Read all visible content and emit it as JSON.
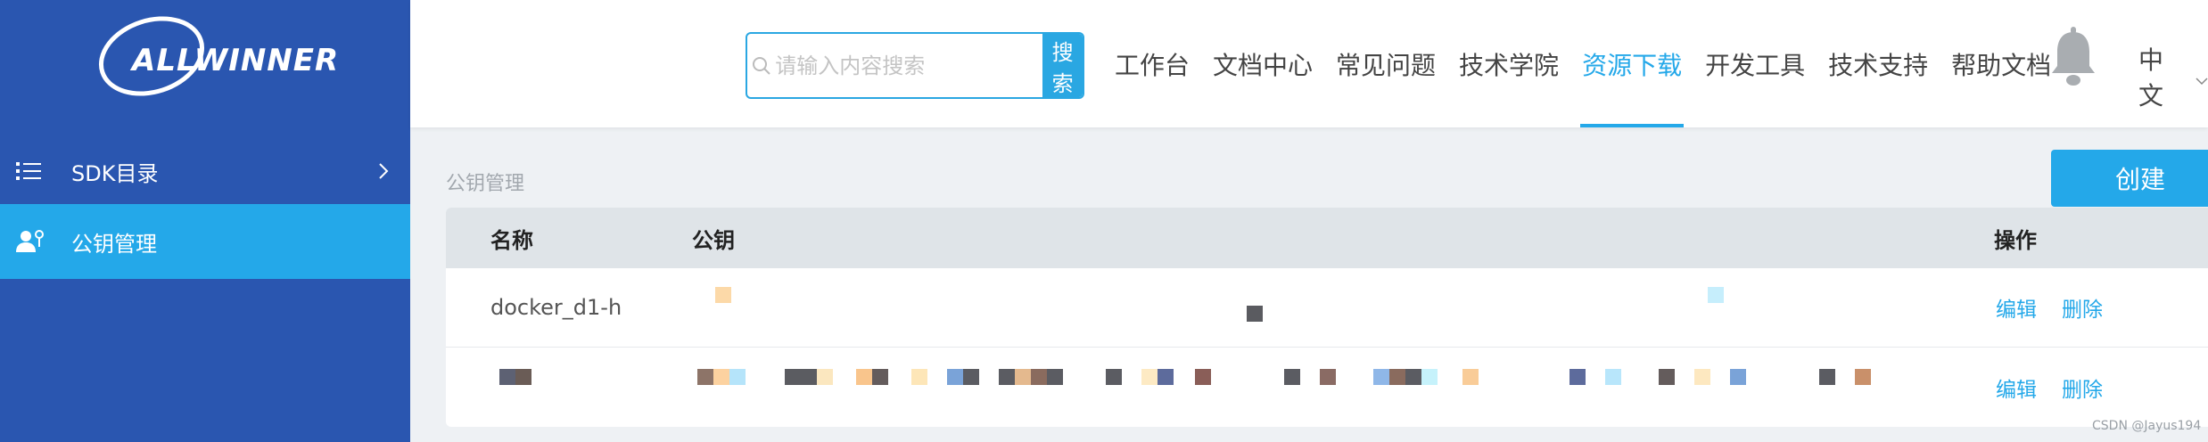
{
  "brand": {
    "logo_text": "ALLWINNER"
  },
  "sidebar": {
    "items": [
      {
        "label": "SDK目录",
        "icon": "list-icon",
        "has_chevron": true,
        "active": false
      },
      {
        "label": "公钥管理",
        "icon": "user-key-icon",
        "active": true
      }
    ]
  },
  "header": {
    "search": {
      "placeholder": "请输入内容搜索",
      "button_label": "搜索"
    },
    "nav": [
      {
        "label": "工作台"
      },
      {
        "label": "文档中心"
      },
      {
        "label": "常见问题"
      },
      {
        "label": "技术学院"
      },
      {
        "label": "资源下载",
        "active": true
      },
      {
        "label": "开发工具"
      },
      {
        "label": "技术支持"
      },
      {
        "label": "帮助文档"
      }
    ],
    "language": "中文"
  },
  "page": {
    "breadcrumb": "公钥管理",
    "create_label": "创建"
  },
  "table": {
    "headers": {
      "name": "名称",
      "key": "公钥",
      "ops": "操作"
    },
    "rows": [
      {
        "name": "docker_d1-h",
        "edit": "编辑",
        "delete": "删除"
      },
      {
        "name": "",
        "edit": "编辑",
        "delete": "删除"
      }
    ]
  },
  "watermark": "CSDN @Jayus194",
  "colors": {
    "sidebar": "#2a56b0",
    "accent": "#24a8e9"
  }
}
